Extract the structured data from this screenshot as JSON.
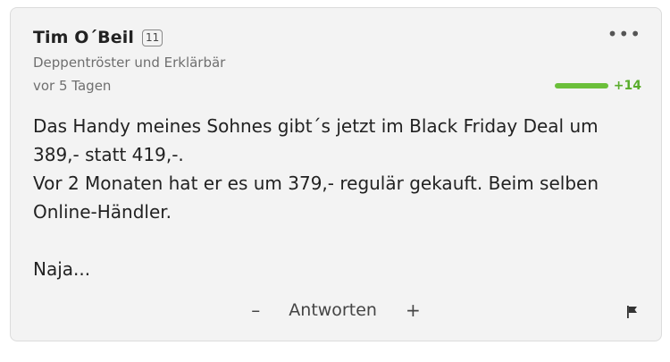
{
  "comment": {
    "author": "Tim O´Beil",
    "level": "11",
    "author_title": "Deppentröster und Erklärbär",
    "timestamp": "vor 5 Tagen",
    "votes": "+14",
    "message_lines": [
      "Das Handy meines Sohnes gibt´s jetzt im Black Friday Deal um",
      "389,- statt 419,-.",
      "Vor 2 Monaten hat er es um 379,- regulär gekauft. Beim selben",
      "Online-Händler.",
      "Naja..."
    ],
    "actions": {
      "minus": "–",
      "reply": "Antworten",
      "plus": "+"
    },
    "icons": {
      "more": "more-options-icon",
      "flag": "flag-icon"
    },
    "colors": {
      "vote_green": "#6bbf3a",
      "card_bg": "#f3f3f3"
    }
  }
}
